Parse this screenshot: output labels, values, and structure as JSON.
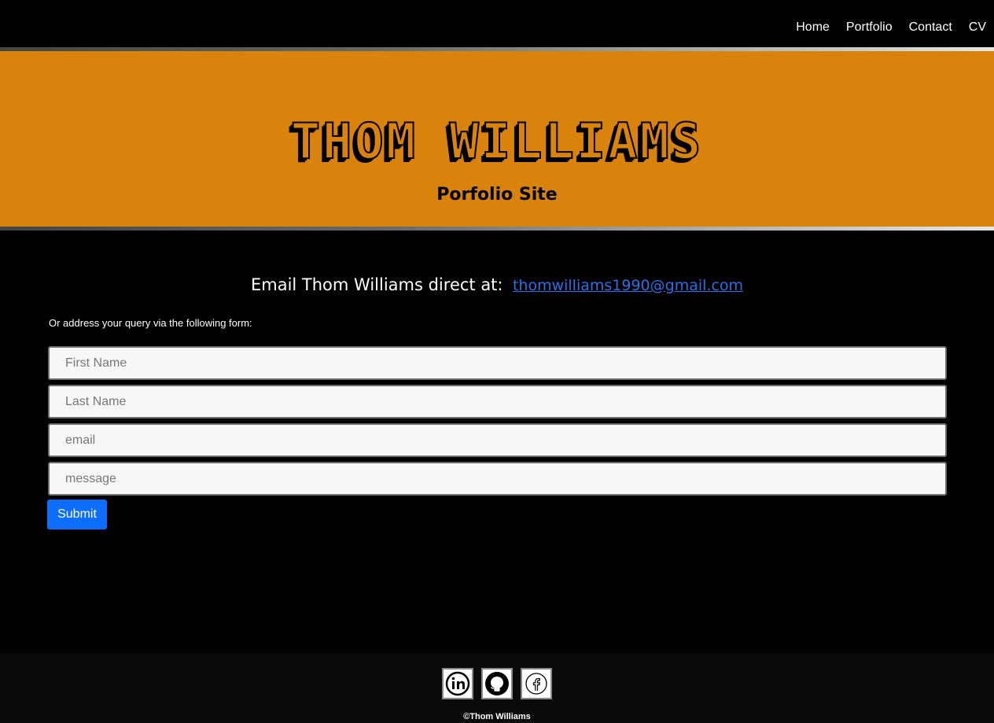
{
  "nav": {
    "links": [
      "Home",
      "Portfolio",
      "Contact",
      "CV"
    ]
  },
  "hero": {
    "title": "THOM WILLIAMS",
    "subtitle": "Porfolio Site"
  },
  "contact": {
    "email_label": "Email Thom Williams direct at:",
    "email": "thomwilliams1990@gmail.com",
    "form_intro": "Or address your query via the following form:",
    "fields": {
      "first_name": "First Name",
      "last_name": "Last Name",
      "email": "email",
      "message": "message"
    },
    "submit_label": "Submit"
  },
  "footer": {
    "social_icons": [
      "linkedin-icon",
      "github-icon",
      "facebook-icon"
    ],
    "copyright": "©Thom Williams"
  },
  "colors": {
    "hero_background": "#d9830d",
    "page_background": "#000000",
    "link_blue": "#2a6ee8",
    "button_blue": "#0d6efd"
  }
}
